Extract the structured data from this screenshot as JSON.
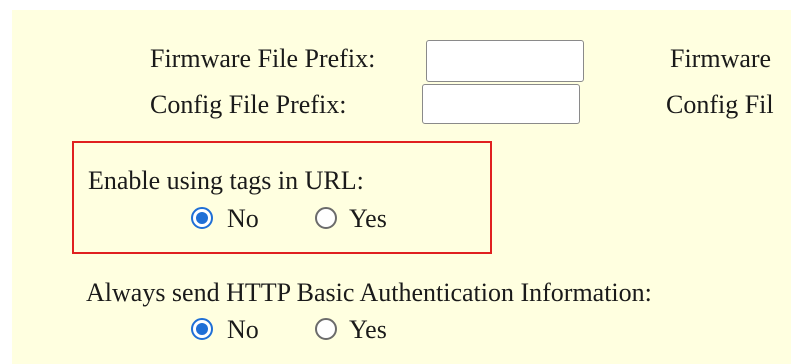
{
  "firmware": {
    "file_prefix_label": "Firmware File Prefix:",
    "file_prefix_value": "",
    "right_label_partial": "Firmware"
  },
  "config": {
    "file_prefix_label": "Config File Prefix:",
    "file_prefix_value": "",
    "right_label_partial": "Config Fil"
  },
  "tags_in_url": {
    "label": "Enable using tags in URL:",
    "options": [
      "No",
      "Yes"
    ],
    "selected": "No"
  },
  "http_basic_auth": {
    "label": "Always send HTTP Basic Authentication Information:",
    "options": [
      "No",
      "Yes"
    ],
    "selected": "No"
  },
  "colors": {
    "background": "#ffffe0",
    "highlight_border": "#e02020",
    "radio_accent": "#1f6fd6"
  }
}
